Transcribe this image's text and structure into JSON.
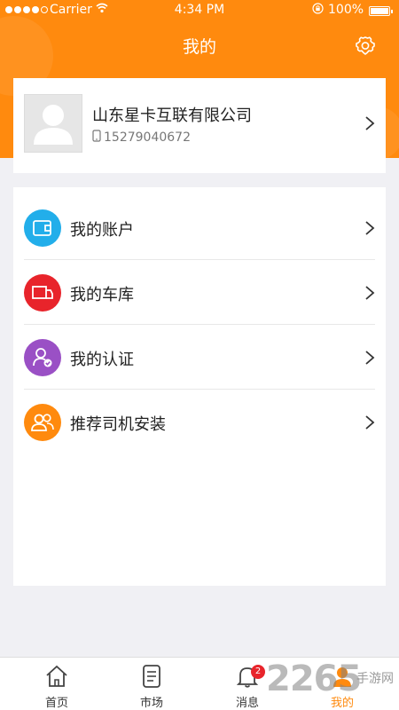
{
  "status_bar": {
    "carrier": "Carrier",
    "time": "4:34 PM",
    "battery": "100%",
    "signal_icon": "signal-dots-icon",
    "wifi_icon": "wifi-icon",
    "lock_icon": "orientation-lock-icon",
    "battery_icon": "battery-icon",
    "battery_level": 1.0
  },
  "header": {
    "title": "我的",
    "settings_icon": "gear-icon",
    "color": "#ff8a0e"
  },
  "profile": {
    "name": "山东星卡互联有限公司",
    "phone": "15279040672",
    "avatar_icon": "default-avatar-icon",
    "phone_icon": "mobile-phone-icon"
  },
  "menu": {
    "items": [
      {
        "label": "我的账户",
        "icon": "wallet-icon",
        "color": "#22aeea"
      },
      {
        "label": "我的车库",
        "icon": "truck-icon",
        "color": "#e8242b"
      },
      {
        "label": "我的认证",
        "icon": "user-check-icon",
        "color": "#9a50c5"
      },
      {
        "label": "推荐司机安装",
        "icon": "users-icon",
        "color": "#ff8a0e"
      }
    ]
  },
  "tabbar": {
    "tabs": [
      {
        "label": "首页",
        "icon": "home-icon"
      },
      {
        "label": "市场",
        "icon": "document-icon"
      },
      {
        "label": "消息",
        "icon": "bell-icon",
        "badge": "2"
      },
      {
        "label": "我的",
        "icon": "user-icon",
        "active": true
      }
    ],
    "active_color": "#ff8a0e"
  },
  "watermark": {
    "number": "2265",
    "text": "手游网"
  }
}
